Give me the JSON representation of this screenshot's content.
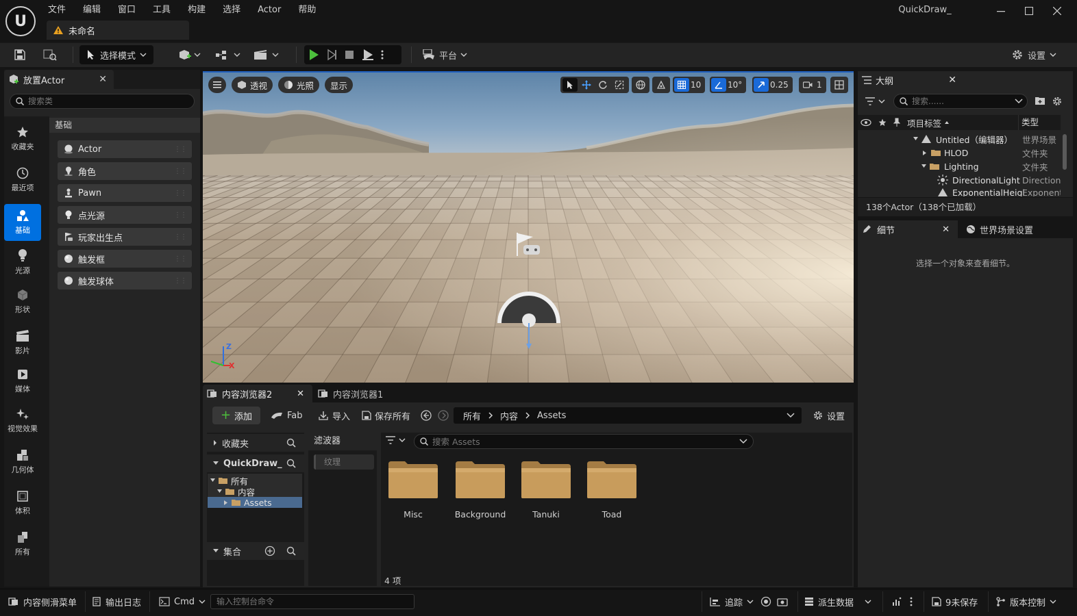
{
  "app": {
    "menu": [
      "文件",
      "编辑",
      "窗口",
      "工具",
      "构建",
      "选择",
      "Actor",
      "帮助"
    ],
    "doc_tab": "未命名",
    "project_name": "QuickDraw_",
    "window_buttons": [
      "minimize-icon",
      "maximize-icon",
      "close-icon"
    ]
  },
  "toolbar": {
    "select_mode": "选择模式",
    "platform": "平台",
    "settings": "设置"
  },
  "place_actors": {
    "tab": "放置Actor",
    "search_placeholder": "搜索类",
    "categories": [
      "收藏夹",
      "最近项",
      "基础",
      "光源",
      "形状",
      "影片",
      "媒体",
      "视觉效果",
      "几何体",
      "体积",
      "所有"
    ],
    "active_category": "基础",
    "group": "基础",
    "items": [
      "Actor",
      "角色",
      "Pawn",
      "点光源",
      "玩家出生点",
      "触发框",
      "触发球体"
    ]
  },
  "viewport": {
    "perspective": "透视",
    "lighting": "光照",
    "show": "显示",
    "grid_snap": "10",
    "rotation_snap": "10°",
    "scale_snap": "0.25",
    "camera_speed": "1",
    "axis_z": "Z",
    "axis_x": "X"
  },
  "content_browser": {
    "tab1": "内容浏览器2",
    "tab2": "内容浏览器1",
    "add": "添加",
    "fab": "Fab",
    "import": "导入",
    "save_all": "保存所有",
    "path": [
      "所有",
      "内容",
      "Assets"
    ],
    "settings": "设置",
    "favorites": "收藏夹",
    "project": "QuickDraw_",
    "tree": [
      "所有",
      "内容",
      "Assets"
    ],
    "collections": "集合",
    "filters": "滤波器",
    "filter_chip": "纹理",
    "search_placeholder": "搜索 Assets",
    "folders": [
      "Misc",
      "Background",
      "Tanuki",
      "Toad"
    ],
    "count": "4 项"
  },
  "outliner": {
    "tab": "大纲",
    "search_placeholder": "搜索......",
    "col_label": "项目标签",
    "col_type": "类型",
    "rows": [
      {
        "label": "Untitled（编辑器）",
        "type": "世界场景"
      },
      {
        "label": "HLOD",
        "type": "文件夹"
      },
      {
        "label": "Lighting",
        "type": "文件夹"
      },
      {
        "label": "DirectionalLight",
        "type": "Directiona"
      },
      {
        "label": "ExponentialHeigl",
        "type": "Exponenti"
      }
    ],
    "footer": "138个Actor（138个已加载）"
  },
  "details": {
    "tab": "细节",
    "world_tab": "世界场景设置",
    "empty_msg": "选择一个对象来查看细节。"
  },
  "statusbar": {
    "content_drawer": "内容侧滑菜单",
    "output_log": "输出日志",
    "cmd": "Cmd",
    "console_placeholder": "输入控制台命令",
    "trace": "追踪",
    "derived_data": "派生数据",
    "unsaved": "9未保存",
    "source_control": "版本控制"
  },
  "colors": {
    "accent": "#0070e0",
    "play_green": "#4cbf3c",
    "folder": "#c8a064",
    "warning": "#e8a020"
  }
}
